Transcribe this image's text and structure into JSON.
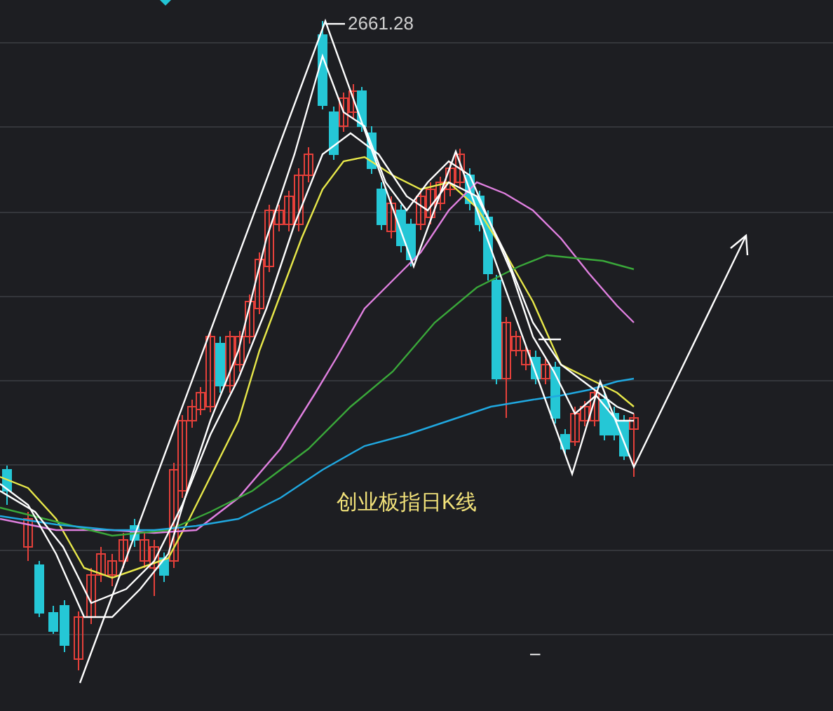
{
  "chart": {
    "title": "创业板指日K线",
    "high_label": "2661.28",
    "dash_mark": "–"
  }
}
